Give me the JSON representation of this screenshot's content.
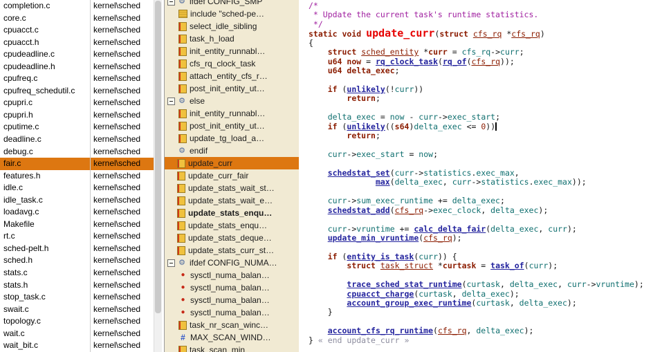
{
  "file_list": {
    "selected_index": 13,
    "rows": [
      {
        "name": "completion.c",
        "path": "kernel\\sched"
      },
      {
        "name": "core.c",
        "path": "kernel\\sched"
      },
      {
        "name": "cpuacct.c",
        "path": "kernel\\sched"
      },
      {
        "name": "cpuacct.h",
        "path": "kernel\\sched"
      },
      {
        "name": "cpudeadline.c",
        "path": "kernel\\sched"
      },
      {
        "name": "cpudeadline.h",
        "path": "kernel\\sched"
      },
      {
        "name": "cpufreq.c",
        "path": "kernel\\sched"
      },
      {
        "name": "cpufreq_schedutil.c",
        "path": "kernel\\sched"
      },
      {
        "name": "cpupri.c",
        "path": "kernel\\sched"
      },
      {
        "name": "cpupri.h",
        "path": "kernel\\sched"
      },
      {
        "name": "cputime.c",
        "path": "kernel\\sched"
      },
      {
        "name": "deadline.c",
        "path": "kernel\\sched"
      },
      {
        "name": "debug.c",
        "path": "kernel\\sched"
      },
      {
        "name": "fair.c",
        "path": "kernel\\sched"
      },
      {
        "name": "features.h",
        "path": "kernel\\sched"
      },
      {
        "name": "idle.c",
        "path": "kernel\\sched"
      },
      {
        "name": "idle_task.c",
        "path": "kernel\\sched"
      },
      {
        "name": "loadavg.c",
        "path": "kernel\\sched"
      },
      {
        "name": "Makefile",
        "path": "kernel\\sched"
      },
      {
        "name": "rt.c",
        "path": "kernel\\sched"
      },
      {
        "name": "sched-pelt.h",
        "path": "kernel\\sched"
      },
      {
        "name": "sched.h",
        "path": "kernel\\sched"
      },
      {
        "name": "stats.c",
        "path": "kernel\\sched"
      },
      {
        "name": "stats.h",
        "path": "kernel\\sched"
      },
      {
        "name": "stop_task.c",
        "path": "kernel\\sched"
      },
      {
        "name": "swait.c",
        "path": "kernel\\sched"
      },
      {
        "name": "topology.c",
        "path": "kernel\\sched"
      },
      {
        "name": "wait.c",
        "path": "kernel\\sched"
      },
      {
        "name": "wait_bit.c",
        "path": "kernel\\sched"
      }
    ]
  },
  "symbols": {
    "selected_index": 13,
    "items": [
      {
        "label": "ifdef CONFIG_SMP",
        "icon": "gear",
        "expander": true,
        "level": 0
      },
      {
        "label": "include \"sched-pe…",
        "icon": "include",
        "level": 1
      },
      {
        "label": "select_idle_sibling",
        "icon": "function",
        "level": 1
      },
      {
        "label": "task_h_load",
        "icon": "function",
        "level": 1
      },
      {
        "label": "init_entity_runnabl…",
        "icon": "function",
        "level": 1
      },
      {
        "label": "cfs_rq_clock_task",
        "icon": "function",
        "level": 1
      },
      {
        "label": "attach_entity_cfs_r…",
        "icon": "function",
        "level": 1
      },
      {
        "label": "post_init_entity_ut…",
        "icon": "function",
        "level": 1
      },
      {
        "label": "else",
        "icon": "gear",
        "expander": true,
        "level": 0
      },
      {
        "label": "init_entity_runnabl…",
        "icon": "function",
        "level": 1
      },
      {
        "label": "post_init_entity_ut…",
        "icon": "function",
        "level": 1
      },
      {
        "label": "update_tg_load_a…",
        "icon": "function",
        "level": 1
      },
      {
        "label": "endif",
        "icon": "gear",
        "level": 0
      },
      {
        "label": "update_curr",
        "icon": "function",
        "level": 0,
        "selected": true
      },
      {
        "label": "update_curr_fair",
        "icon": "function",
        "level": 0
      },
      {
        "label": "update_stats_wait_st…",
        "icon": "function",
        "level": 0
      },
      {
        "label": "update_stats_wait_e…",
        "icon": "function",
        "level": 0
      },
      {
        "label": "update_stats_enqu…",
        "icon": "function",
        "level": 0,
        "bold": true
      },
      {
        "label": "update_stats_enqu…",
        "icon": "function",
        "level": 0
      },
      {
        "label": "update_stats_deque…",
        "icon": "function",
        "level": 0
      },
      {
        "label": "update_stats_curr_st…",
        "icon": "function",
        "level": 0
      },
      {
        "label": "ifdef CONFIG_NUMA…",
        "icon": "gear",
        "expander": true,
        "level": 0
      },
      {
        "label": "sysctl_numa_balan…",
        "icon": "variable",
        "level": 1
      },
      {
        "label": "sysctl_numa_balan…",
        "icon": "variable",
        "level": 1
      },
      {
        "label": "sysctl_numa_balan…",
        "icon": "variable",
        "level": 1
      },
      {
        "label": "sysctl_numa_balan…",
        "icon": "variable",
        "level": 1
      },
      {
        "label": "task_nr_scan_winc…",
        "icon": "function",
        "level": 1
      },
      {
        "label": "MAX_SCAN_WIND…",
        "icon": "define",
        "level": 1
      },
      {
        "label": "task_scan_min",
        "icon": "function",
        "level": 1
      }
    ]
  },
  "code": {
    "lines": [
      [
        [
          "c",
          "/*"
        ]
      ],
      [
        [
          "c",
          " * Update the current task's runtime statistics."
        ]
      ],
      [
        [
          "c",
          " */"
        ]
      ],
      [
        [
          "k",
          "static void "
        ],
        [
          "f",
          "update_curr"
        ],
        [
          "p",
          "("
        ],
        [
          "k",
          "struct"
        ],
        [
          "p",
          " "
        ],
        [
          "t",
          "cfs_rq"
        ],
        [
          "p",
          " *"
        ],
        [
          "t",
          "cfs_rq"
        ],
        [
          "p",
          ")"
        ]
      ],
      [
        [
          "p",
          "{"
        ]
      ],
      [
        [
          "p",
          "    "
        ],
        [
          "k",
          "struct"
        ],
        [
          "p",
          " "
        ],
        [
          "t",
          "sched_entity"
        ],
        [
          "p",
          " *"
        ],
        [
          "d",
          "curr"
        ],
        [
          "p",
          " = "
        ],
        [
          "v",
          "cfs_rq"
        ],
        [
          "p",
          "->"
        ],
        [
          "v",
          "curr"
        ],
        [
          "p",
          ";"
        ]
      ],
      [
        [
          "p",
          "    "
        ],
        [
          "k",
          "u64"
        ],
        [
          "p",
          " "
        ],
        [
          "d",
          "now"
        ],
        [
          "p",
          " = "
        ],
        [
          "l",
          "rq_clock_task"
        ],
        [
          "p",
          "("
        ],
        [
          "l",
          "rq_of"
        ],
        [
          "p",
          "("
        ],
        [
          "t",
          "cfs_rq"
        ],
        [
          "p",
          "));"
        ]
      ],
      [
        [
          "p",
          "    "
        ],
        [
          "k",
          "u64"
        ],
        [
          "p",
          " "
        ],
        [
          "d",
          "delta_exec"
        ],
        [
          "p",
          ";"
        ]
      ],
      [],
      [
        [
          "p",
          "    "
        ],
        [
          "k",
          "if"
        ],
        [
          "p",
          " ("
        ],
        [
          "l",
          "unlikely"
        ],
        [
          "p",
          "(!"
        ],
        [
          "v",
          "curr"
        ],
        [
          "p",
          "))"
        ]
      ],
      [
        [
          "p",
          "        "
        ],
        [
          "k",
          "return"
        ],
        [
          "p",
          ";"
        ]
      ],
      [],
      [
        [
          "p",
          "    "
        ],
        [
          "v",
          "delta_exec"
        ],
        [
          "p",
          " = "
        ],
        [
          "v",
          "now"
        ],
        [
          "p",
          " - "
        ],
        [
          "v",
          "curr"
        ],
        [
          "p",
          "->"
        ],
        [
          "v",
          "exec_start"
        ],
        [
          "p",
          ";"
        ]
      ],
      [
        [
          "p",
          "    "
        ],
        [
          "k",
          "if"
        ],
        [
          "p",
          " ("
        ],
        [
          "l",
          "unlikely"
        ],
        [
          "p",
          "(("
        ],
        [
          "k",
          "s64"
        ],
        [
          "p",
          ")"
        ],
        [
          "v",
          "delta_exec"
        ],
        [
          "p",
          " <= "
        ],
        [
          "n",
          "0"
        ],
        [
          "p",
          "))"
        ],
        [
          "caret",
          ""
        ]
      ],
      [
        [
          "p",
          "        "
        ],
        [
          "k",
          "return"
        ],
        [
          "p",
          ";"
        ]
      ],
      [],
      [
        [
          "p",
          "    "
        ],
        [
          "v",
          "curr"
        ],
        [
          "p",
          "->"
        ],
        [
          "v",
          "exec_start"
        ],
        [
          "p",
          " = "
        ],
        [
          "v",
          "now"
        ],
        [
          "p",
          ";"
        ]
      ],
      [],
      [
        [
          "p",
          "    "
        ],
        [
          "l",
          "schedstat_set"
        ],
        [
          "p",
          "("
        ],
        [
          "v",
          "curr"
        ],
        [
          "p",
          "->"
        ],
        [
          "v",
          "statistics"
        ],
        [
          "p",
          "."
        ],
        [
          "v",
          "exec_max"
        ],
        [
          "p",
          ","
        ]
      ],
      [
        [
          "p",
          "              "
        ],
        [
          "l",
          "max"
        ],
        [
          "p",
          "("
        ],
        [
          "v",
          "delta_exec"
        ],
        [
          "p",
          ", "
        ],
        [
          "v",
          "curr"
        ],
        [
          "p",
          "->"
        ],
        [
          "v",
          "statistics"
        ],
        [
          "p",
          "."
        ],
        [
          "v",
          "exec_max"
        ],
        [
          "p",
          "));"
        ]
      ],
      [],
      [
        [
          "p",
          "    "
        ],
        [
          "v",
          "curr"
        ],
        [
          "p",
          "->"
        ],
        [
          "v",
          "sum_exec_runtime"
        ],
        [
          "p",
          " += "
        ],
        [
          "v",
          "delta_exec"
        ],
        [
          "p",
          ";"
        ]
      ],
      [
        [
          "p",
          "    "
        ],
        [
          "l",
          "schedstat_add"
        ],
        [
          "p",
          "("
        ],
        [
          "t",
          "cfs_rq"
        ],
        [
          "p",
          "->"
        ],
        [
          "v",
          "exec_clock"
        ],
        [
          "p",
          ", "
        ],
        [
          "v",
          "delta_exec"
        ],
        [
          "p",
          ");"
        ]
      ],
      [],
      [
        [
          "p",
          "    "
        ],
        [
          "v",
          "curr"
        ],
        [
          "p",
          "->"
        ],
        [
          "v",
          "vruntime"
        ],
        [
          "p",
          " += "
        ],
        [
          "l",
          "calc_delta_fair"
        ],
        [
          "p",
          "("
        ],
        [
          "v",
          "delta_exec"
        ],
        [
          "p",
          ", "
        ],
        [
          "v",
          "curr"
        ],
        [
          "p",
          ");"
        ]
      ],
      [
        [
          "p",
          "    "
        ],
        [
          "l",
          "update_min_vruntime"
        ],
        [
          "p",
          "("
        ],
        [
          "t",
          "cfs_rq"
        ],
        [
          "p",
          ");"
        ]
      ],
      [],
      [
        [
          "p",
          "    "
        ],
        [
          "k",
          "if"
        ],
        [
          "p",
          " ("
        ],
        [
          "l",
          "entity_is_task"
        ],
        [
          "p",
          "("
        ],
        [
          "v",
          "curr"
        ],
        [
          "p",
          ")) {"
        ]
      ],
      [
        [
          "p",
          "        "
        ],
        [
          "k",
          "struct"
        ],
        [
          "p",
          " "
        ],
        [
          "t",
          "task_struct"
        ],
        [
          "p",
          " *"
        ],
        [
          "d",
          "curtask"
        ],
        [
          "p",
          " = "
        ],
        [
          "l",
          "task_of"
        ],
        [
          "p",
          "("
        ],
        [
          "v",
          "curr"
        ],
        [
          "p",
          ");"
        ]
      ],
      [],
      [
        [
          "p",
          "        "
        ],
        [
          "l",
          "trace_sched_stat_runtime"
        ],
        [
          "p",
          "("
        ],
        [
          "v",
          "curtask"
        ],
        [
          "p",
          ", "
        ],
        [
          "v",
          "delta_exec"
        ],
        [
          "p",
          ", "
        ],
        [
          "v",
          "curr"
        ],
        [
          "p",
          "->"
        ],
        [
          "v",
          "vruntime"
        ],
        [
          "p",
          ");"
        ]
      ],
      [
        [
          "p",
          "        "
        ],
        [
          "l",
          "cpuacct_charge"
        ],
        [
          "p",
          "("
        ],
        [
          "v",
          "curtask"
        ],
        [
          "p",
          ", "
        ],
        [
          "v",
          "delta_exec"
        ],
        [
          "p",
          ");"
        ]
      ],
      [
        [
          "p",
          "        "
        ],
        [
          "l",
          "account_group_exec_runtime"
        ],
        [
          "p",
          "("
        ],
        [
          "v",
          "curtask"
        ],
        [
          "p",
          ", "
        ],
        [
          "v",
          "delta_exec"
        ],
        [
          "p",
          ");"
        ]
      ],
      [
        [
          "p",
          "    }"
        ]
      ],
      [],
      [
        [
          "p",
          "    "
        ],
        [
          "l",
          "account_cfs_rq_runtime"
        ],
        [
          "p",
          "("
        ],
        [
          "t",
          "cfs_rq"
        ],
        [
          "p",
          ", "
        ],
        [
          "v",
          "delta_exec"
        ],
        [
          "p",
          ");"
        ]
      ],
      [
        [
          "p",
          "} "
        ],
        [
          "e",
          "« end update_curr »"
        ]
      ]
    ]
  },
  "colors": {
    "selection_orange": "#DD7711",
    "symbol_panel_bg": "#F1EAD3",
    "comment": "#A020A0",
    "keyword": "#8B1C00",
    "function_def": "#E60000",
    "link": "#24249E",
    "member": "#0F6F6F"
  }
}
